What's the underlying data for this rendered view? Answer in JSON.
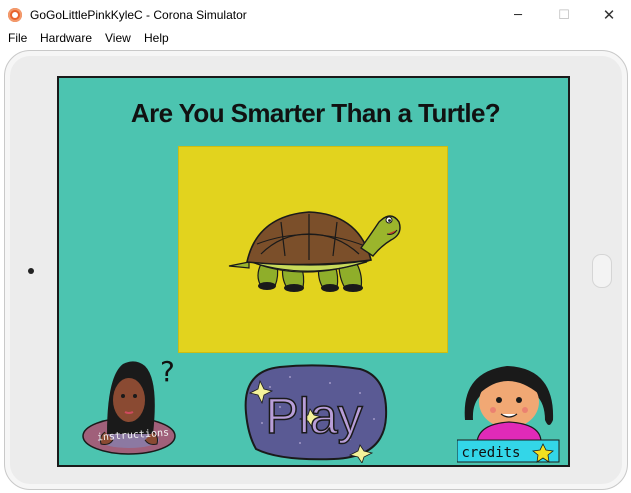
{
  "window": {
    "title": "GoGoLittlePinkKyleC - Corona Simulator",
    "app_icon": "corona-logo-icon",
    "controls": {
      "minimize": "─",
      "maximize": "☐",
      "close": "✕"
    }
  },
  "menu": {
    "items": [
      "File",
      "Hardware",
      "View",
      "Help"
    ]
  },
  "game": {
    "title": "Are You Smarter Than a Turtle?",
    "panel_color": "#e2d31e",
    "background_color": "#4cc4b0",
    "instructions": {
      "label": "instructions",
      "question_mark": "?"
    },
    "play": {
      "label": "Play"
    },
    "credits": {
      "label": "credits"
    }
  }
}
